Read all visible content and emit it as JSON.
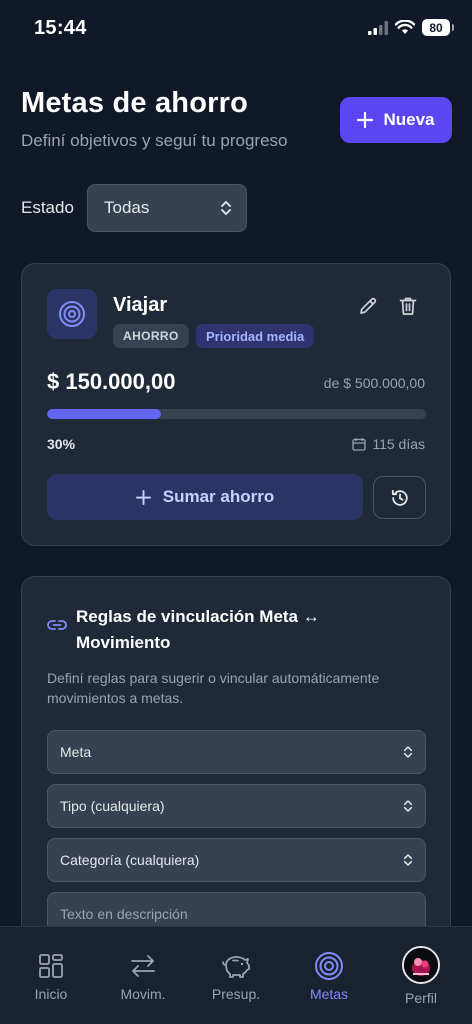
{
  "status_bar": {
    "time": "15:44",
    "battery": "80"
  },
  "header": {
    "title": "Metas de ahorro",
    "subtitle": "Definí objetivos y seguí tu progreso",
    "new_button_label": "Nueva"
  },
  "filter": {
    "label": "Estado",
    "selected": "Todas"
  },
  "goal": {
    "name": "Viajar",
    "type_badge": "AHORRO",
    "priority_badge": "Prioridad media",
    "current_amount": "$ 150.000,00",
    "target_amount": "de $ 500.000,00",
    "progress": 0.3,
    "progress_label": "30%",
    "days_left": "115 días",
    "add_button_label": "Sumar ahorro"
  },
  "rules": {
    "title": "Reglas de vinculación Meta ↔ Movimiento",
    "description": "Definí reglas para sugerir o vincular automáticamente movimientos a metas.",
    "selects": [
      {
        "value": "Meta"
      },
      {
        "value": "Tipo (cualquiera)"
      },
      {
        "value": "Categoría (cualquiera)"
      }
    ],
    "text_placeholder": "Texto en descripción"
  },
  "nav": {
    "items": [
      {
        "label": "Inicio",
        "icon": "grid-icon"
      },
      {
        "label": "Movim.",
        "icon": "arrows-icon"
      },
      {
        "label": "Presup.",
        "icon": "piggy-bank-icon"
      },
      {
        "label": "Metas",
        "icon": "target-icon",
        "active": true
      },
      {
        "label": "Perfil",
        "icon": "avatar"
      }
    ]
  },
  "colors": {
    "background": "#111827",
    "card": "#1f2937",
    "accent": "#5b46f2",
    "progress": "#6366f1",
    "active_nav": "#818cf8"
  }
}
